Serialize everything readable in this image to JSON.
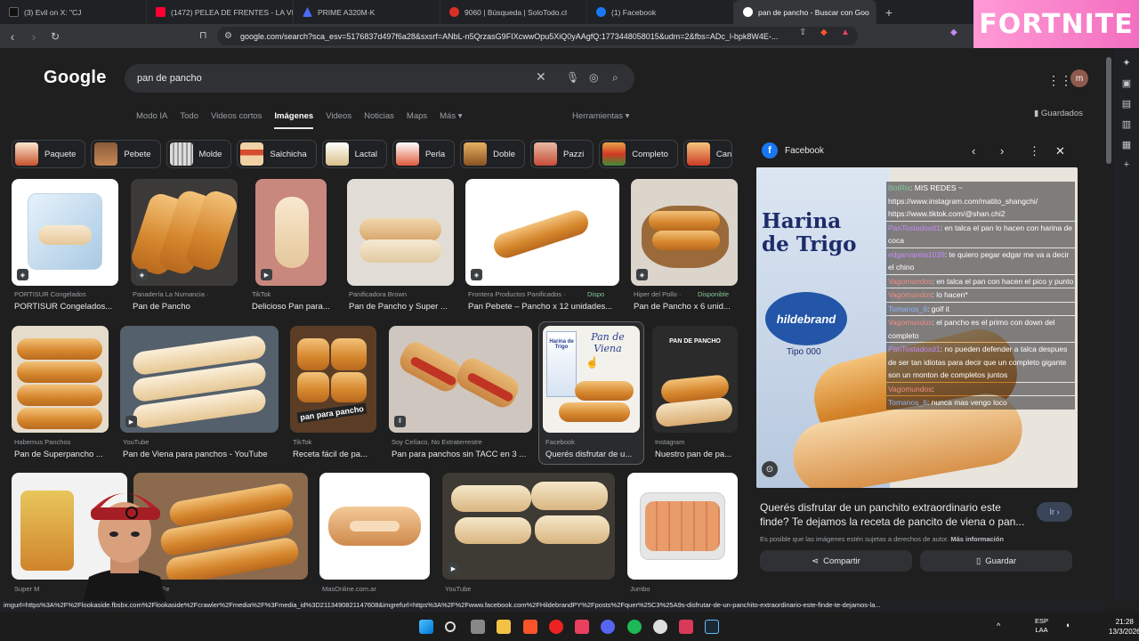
{
  "tabs": [
    {
      "label": "(3) Evil  on X: \"CJ",
      "color": "#111111"
    },
    {
      "label": "(1472) PELEA DE FRENTES - LA VI",
      "color": "#ff0033"
    },
    {
      "label": "PRIME A320M-K",
      "color": "#4a6cf7"
    },
    {
      "label": "9060 | Búsqueda | SoloTodo.cl",
      "color": "#d93025"
    },
    {
      "label": "(1) Facebook",
      "color": "#1877f2"
    },
    {
      "label": "pan de pancho - Buscar con Goo",
      "color": "#ffffff"
    }
  ],
  "fortnite_banner": "FORTNITE",
  "address": "google.com/search?sca_esv=5176837d497f6a28&sxsrf=ANbL-n5QrzasG9FIXcwwOpu5XiQ0yAAgfQ:1773448058015&udm=2&fbs=ADc_l-bpk8W4E-...",
  "google": {
    "logo": "Google",
    "query": "pan de pancho",
    "avatar_letter": "m",
    "nav_tabs": [
      "Modo IA",
      "Todo",
      "Videos cortos",
      "Imágenes",
      "Videos",
      "Noticias",
      "Maps",
      "Más ▾"
    ],
    "tools": "Herramientas ▾",
    "saved": "Guardados"
  },
  "chips": [
    "Paquete",
    "Pebete",
    "Molde",
    "Salchicha",
    "Lactal",
    "Perla",
    "Doble",
    "Pazzi",
    "Completo",
    "Can"
  ],
  "results": [
    {
      "source": "PORTISUR Congelados",
      "caption": "PORTISUR Congelados...",
      "avail": ""
    },
    {
      "source": "Panadería La Numancia ·",
      "caption": "Pan de Pancho",
      "avail": ""
    },
    {
      "source": "TikTok",
      "caption": "Delicioso Pan para...",
      "avail": ""
    },
    {
      "source": "Panificadora Brown",
      "caption": "Pan de Pancho y Super ...",
      "avail": ""
    },
    {
      "source": "Frontera Productos Panificados ·",
      "caption": "Pan Pebete – Pancho x 12 unidades...",
      "avail": "Dispo"
    },
    {
      "source": "Hiper del Pollo ·",
      "caption": "Pan de Pancho x 6 unid...",
      "avail": "Disponible"
    },
    {
      "source": "Habemus Panchos",
      "caption": "Pan de Superpancho ...",
      "avail": ""
    },
    {
      "source": "YouTube",
      "caption": "Pan de Viena para panchos - YouTube",
      "avail": ""
    },
    {
      "source": "TikTok",
      "caption": "Receta fácil de pa...",
      "avail": ""
    },
    {
      "source": "Soy Celíaco, No Extraterrestre",
      "caption": "Pan para panchos sin TACC en 3 ...",
      "avail": ""
    },
    {
      "source": "Facebook",
      "caption": "Querés disfrutar de u...",
      "avail": ""
    },
    {
      "source": "Instagram",
      "caption": "Nuestro pan de pa...",
      "avail": ""
    },
    {
      "source": "Super M",
      "caption": "",
      "avail": ""
    },
    {
      "source": "Santa Fe",
      "caption": "",
      "avail": ""
    },
    {
      "source": "MasOnline.com.ar",
      "caption": "",
      "avail": ""
    },
    {
      "source": "YouTube",
      "caption": "",
      "avail": ""
    },
    {
      "source": "Jumbo",
      "caption": "",
      "avail": ""
    }
  ],
  "image_labels": {
    "para_pancho": "pan para pancho",
    "viena_title": "Pan de Viena",
    "harina_small": "Harina de Trigo",
    "pan_de_pancho_poster": "PAN DE PANCHO"
  },
  "panel": {
    "site": "Facebook",
    "image_text_1": "Harina",
    "image_text_2": "de Trigo",
    "image_brand": "hildebrand",
    "image_type": "Tipo 000",
    "title": "Querés disfrutar de un panchito extraordinario este finde? Te dejamos la receta de pancito de viena o pan...",
    "go": "Ir ›",
    "copyright": "Es posible que las imágenes estén sujetas a derechos de autor.",
    "more_info": "Más información",
    "share": "Compartir",
    "save": "Guardar"
  },
  "chat": [
    {
      "user": "BotRix",
      "text": ": MIS REDES ~ https://www.instagram.com/matito_shangchi/ https://www.tiktok.com/@shan.chi2"
    },
    {
      "user": "PanTostadoxd1",
      "text": ": en talca el pan lo hacen con harina de coca"
    },
    {
      "user": "edgarvarela1039",
      "text": ": te quiero pegar edgar me va a decir el chino"
    },
    {
      "user": "Vagomundos",
      "text": ": en talca el pan con hacen el pico y punto"
    },
    {
      "user": "Vagomundos",
      "text": ": lo hacen*"
    },
    {
      "user": "Tomanos_6",
      "text": ": golf it"
    },
    {
      "user": "Vagomundos",
      "text": ": el pancho es el primo con down del completo"
    },
    {
      "user": "PanTostadoxd1",
      "text": ": no pueden defender a talca despues de ser tan idiotas    para decir que un completo gigante son un monton de completos juntos"
    },
    {
      "user": "Vagomundos",
      "text": ":"
    },
    {
      "user": "Tomanos_6",
      "text": ": nunca mas vengo loco"
    }
  ],
  "status_url": "imgurl=https%3A%2F%2Flookaside.fbsbx.com%2Flookaside%2Fcrawler%2Fmedia%2F%3Fmedia_id%3D2113490821147608&imgrefurl=https%3A%2F%2Fwww.facebook.com%2FHildebrandPY%2Fposts%2Fquer%25C3%25A9s-disfrutar-de-un-panchito-extraordinario-este-finde-te-dejamos-la...",
  "taskbar": {
    "lang_1": "ESP",
    "lang_2": "LAA",
    "time": "21:28",
    "date": "13/3/2026"
  }
}
